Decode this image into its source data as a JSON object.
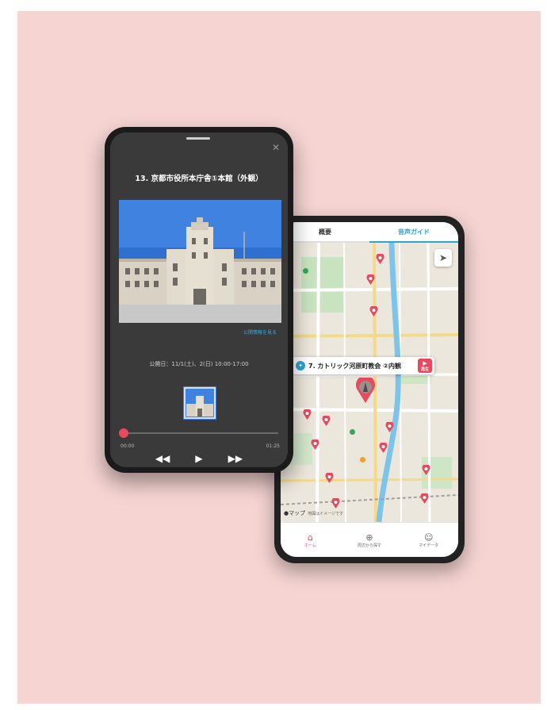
{
  "map_screen": {
    "tabs": [
      "概要",
      "音声ガイド"
    ],
    "active_tab": 1,
    "callout": {
      "label": "7. カトリック河原町教会 ②内観",
      "play_label": "再生"
    },
    "footer": {
      "label": "●マップ",
      "sub": "地図はイメージです"
    },
    "nav": [
      {
        "label": "ホーム",
        "icon": "home-icon"
      },
      {
        "label": "周辺から探す",
        "icon": "search-nearby-icon"
      },
      {
        "label": "マイデータ",
        "icon": "user-icon"
      }
    ],
    "colors": {
      "accent": "#2aa5d4",
      "pin": "#e8495e"
    }
  },
  "audio_screen": {
    "title": "13. 京都市役所本庁舎①本館（外観）",
    "photo_link": "公開情報を見る",
    "hours": "公開日：11/1(土)、2(日) 10:00-17:00",
    "progress": 0,
    "time_current": "00:00",
    "time_total": "01:25",
    "controls": [
      "◀◀",
      "▶",
      "▶▶"
    ]
  }
}
